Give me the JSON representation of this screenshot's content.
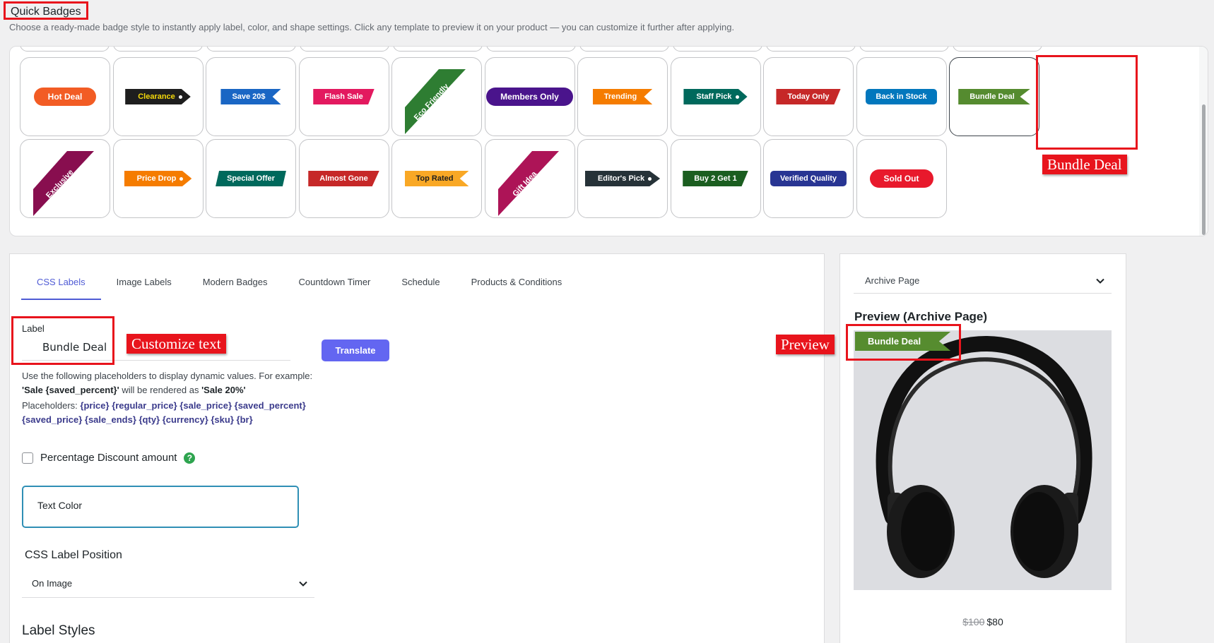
{
  "quick_badges": {
    "title": "Quick Badges",
    "description": "Choose a ready-made badge style to instantly apply label, color, and shape settings. Click any template to preview it on your product — you can customize it further after applying.",
    "row1": [
      {
        "label": "Hot Deal",
        "color": "#f25c24",
        "text_color": "#ffffff",
        "shape": "pill"
      },
      {
        "label": "Clearance",
        "color": "#1e1e1e",
        "text_color": "#f5d90a",
        "shape": "tag"
      },
      {
        "label": "Save 20$",
        "color": "#1a66c4",
        "text_color": "#ffffff",
        "shape": "ribbon-notch"
      },
      {
        "label": "Flash Sale",
        "color": "#e3195f",
        "text_color": "#ffffff",
        "shape": "ribbon"
      },
      {
        "label": "Eco Friendly",
        "color": "#2e7d32",
        "text_color": "#ffffff",
        "shape": "corner"
      },
      {
        "label": "Members Only",
        "color": "#4a148c",
        "text_color": "#ffffff",
        "shape": "pill"
      },
      {
        "label": "Trending",
        "color": "#f57c00",
        "text_color": "#ffffff",
        "shape": "ribbon-notch"
      },
      {
        "label": "Staff Pick",
        "color": "#00695c",
        "text_color": "#ffffff",
        "shape": "tag"
      },
      {
        "label": "Today Only",
        "color": "#c62828",
        "text_color": "#ffffff",
        "shape": "ribbon"
      },
      {
        "label": "Back in Stock",
        "color": "#0277bd",
        "text_color": "#ffffff",
        "shape": "pill-square"
      },
      {
        "label": "Bundle Deal",
        "color": "#558b2f",
        "text_color": "#ffffff",
        "shape": "ribbon-notch"
      }
    ],
    "row2": [
      {
        "label": "Exclusive",
        "color": "#880e4f",
        "text_color": "#ffffff",
        "shape": "corner"
      },
      {
        "label": "Price Drop",
        "color": "#f57c00",
        "text_color": "#ffffff",
        "shape": "tag"
      },
      {
        "label": "Special Offer",
        "color": "#00695c",
        "text_color": "#ffffff",
        "shape": "para"
      },
      {
        "label": "Almost Gone",
        "color": "#c62828",
        "text_color": "#ffffff",
        "shape": "ribbon"
      },
      {
        "label": "Top Rated",
        "color": "#f9a825",
        "text_color": "#1e1e1e",
        "shape": "ribbon-notch"
      },
      {
        "label": "Gift Idea",
        "color": "#ad1457",
        "text_color": "#ffffff",
        "shape": "corner"
      },
      {
        "label": "Editor's Pick",
        "color": "#263238",
        "text_color": "#ffffff",
        "shape": "tag"
      },
      {
        "label": "Buy 2 Get 1",
        "color": "#1b5e20",
        "text_color": "#ffffff",
        "shape": "ribbon"
      },
      {
        "label": "Verified Quality",
        "color": "#283593",
        "text_color": "#ffffff",
        "shape": "pill-square"
      },
      {
        "label": "Sold Out",
        "color": "#e8192c",
        "text_color": "#ffffff",
        "shape": "pill"
      }
    ],
    "selected_callout": "Bundle Deal"
  },
  "tabs": [
    "CSS Labels",
    "Image Labels",
    "Modern Badges",
    "Countdown Timer",
    "Schedule",
    "Products & Conditions"
  ],
  "active_tab": "CSS Labels",
  "form": {
    "label_title": "Label",
    "label_value": "Bundle Deal",
    "customize_callout": "Customize text",
    "translate_button": "Translate",
    "help_line1": "Use the following placeholders to display dynamic values. For example:",
    "help_example_a": "'Sale {saved_percent}'",
    "help_example_mid": " will be rendered as ",
    "help_example_b": "'Sale 20%'",
    "placeholders_label": "Placeholders: ",
    "placeholders_line1": "{price} {regular_price} {sale_price} {saved_percent}",
    "placeholders_line2": "{saved_price} {sale_ends} {qty} {currency} {sku} {br}",
    "percentage_discount": "Percentage Discount amount",
    "help_icon": "?",
    "text_color": "Text Color",
    "position_title": "CSS Label Position",
    "position_value": "On Image",
    "label_styles_title": "Label Styles"
  },
  "preview": {
    "page_select": "Archive Page",
    "title": "Preview (Archive Page)",
    "callout": "Preview",
    "badge_label": "Bundle Deal",
    "badge_color": "#568c2f",
    "old_price": "$100",
    "new_price": "$80",
    "product_image": "headphones"
  },
  "colors": {
    "accent": "#4f5bd5",
    "translate_button": "#6366f1",
    "callout_red": "#e8141c"
  }
}
